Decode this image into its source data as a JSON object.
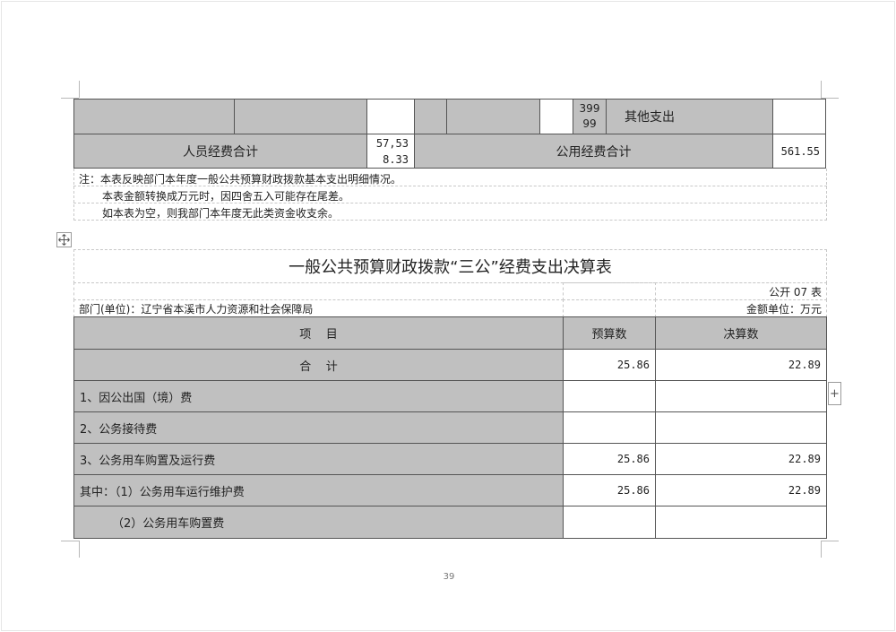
{
  "top_table": {
    "row1": {
      "code_line1": "399",
      "code_line2": "99",
      "label": "其他支出"
    },
    "row2": {
      "personnel_total_label": "人员经费合计",
      "personnel_total_line1": "57,53",
      "personnel_total_line2": "8.33",
      "public_total_label": "公用经费合计",
      "public_total_value": "561.55"
    },
    "notes": [
      "注：本表反映部门本年度一般公共预算财政拨款基本支出明细情况。",
      "本表金额转换成万元时，因四舍五入可能存在尾差。",
      "如本表为空，则我部门本年度无此类资金收支余。"
    ]
  },
  "table": {
    "title": "一般公共预算财政拨款“三公”经费支出决算表",
    "code": "公开 07 表",
    "department": "部门(单位)：辽宁省本溪市人力资源和社会保障局",
    "unit": "金额单位：万元",
    "headers": {
      "item": "项    目",
      "budget": "预算数",
      "actual": "决算数"
    },
    "rows": [
      {
        "label": "合    计",
        "budget": "25.86",
        "actual": "22.89"
      },
      {
        "label": "1、因公出国（境）费",
        "budget": "",
        "actual": ""
      },
      {
        "label": "2、公务接待费",
        "budget": "",
        "actual": ""
      },
      {
        "label": "3、公务用车购置及运行费",
        "budget": "25.86",
        "actual": "22.89"
      },
      {
        "label": "其中：（1）公务用车运行维护费",
        "budget": "25.86",
        "actual": "22.89"
      },
      {
        "label": "（2）公务用车购置费",
        "budget": "",
        "actual": ""
      }
    ]
  },
  "page_number": "39",
  "icons": {
    "move_handle": "move-icon",
    "add_row": "plus-icon"
  }
}
